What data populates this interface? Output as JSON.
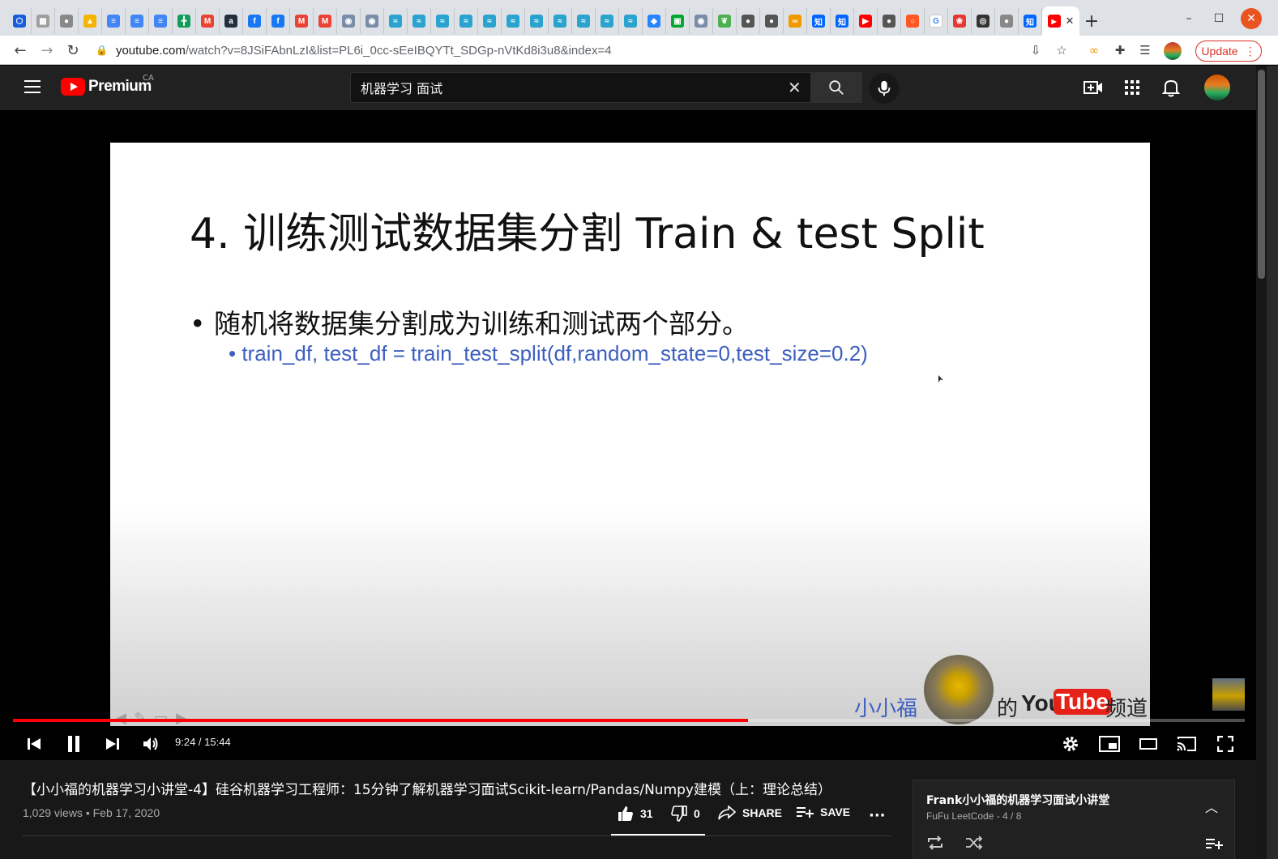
{
  "browser": {
    "tab_favicons": [
      {
        "name": "bitwarden",
        "color": "#175ddc",
        "glyph": "⬡"
      },
      {
        "name": "app",
        "color": "#9e9e9e",
        "glyph": "▦"
      },
      {
        "name": "github",
        "color": "#888888",
        "glyph": "●"
      },
      {
        "name": "google-drive",
        "color": "#f4b400",
        "glyph": "▲"
      },
      {
        "name": "google-docs",
        "color": "#4285f4",
        "glyph": "≡"
      },
      {
        "name": "google-docs",
        "color": "#4285f4",
        "glyph": "≡"
      },
      {
        "name": "google-docs",
        "color": "#4285f4",
        "glyph": "≡"
      },
      {
        "name": "google-sheets",
        "color": "#0f9d58",
        "glyph": "╋"
      },
      {
        "name": "gmail",
        "color": "#ea4335",
        "glyph": "M"
      },
      {
        "name": "amazon",
        "color": "#232f3e",
        "glyph": "a"
      },
      {
        "name": "facebook",
        "color": "#1877f2",
        "glyph": "f"
      },
      {
        "name": "facebook",
        "color": "#1877f2",
        "glyph": "f"
      },
      {
        "name": "gmail",
        "color": "#ea4335",
        "glyph": "M"
      },
      {
        "name": "gmail",
        "color": "#ea4335",
        "glyph": "M"
      },
      {
        "name": "site",
        "color": "#7a8ca8",
        "glyph": "◉"
      },
      {
        "name": "site",
        "color": "#7a8ca8",
        "glyph": "◉"
      },
      {
        "name": "site",
        "color": "#2aa3cf",
        "glyph": "≈"
      },
      {
        "name": "site",
        "color": "#2aa3cf",
        "glyph": "≈"
      },
      {
        "name": "site",
        "color": "#2aa3cf",
        "glyph": "≈"
      },
      {
        "name": "site",
        "color": "#2aa3cf",
        "glyph": "≈"
      },
      {
        "name": "site",
        "color": "#2aa3cf",
        "glyph": "≈"
      },
      {
        "name": "site",
        "color": "#2aa3cf",
        "glyph": "≈"
      },
      {
        "name": "site",
        "color": "#2aa3cf",
        "glyph": "≈"
      },
      {
        "name": "site",
        "color": "#2aa3cf",
        "glyph": "≈"
      },
      {
        "name": "site",
        "color": "#2aa3cf",
        "glyph": "≈"
      },
      {
        "name": "site",
        "color": "#2aa3cf",
        "glyph": "≈"
      },
      {
        "name": "site",
        "color": "#2aa3cf",
        "glyph": "≈"
      },
      {
        "name": "jira",
        "color": "#2684ff",
        "glyph": "◆"
      },
      {
        "name": "evernote",
        "color": "#00a82d",
        "glyph": "▣"
      },
      {
        "name": "site",
        "color": "#7a8ca8",
        "glyph": "◉"
      },
      {
        "name": "leaf",
        "color": "#4caf50",
        "glyph": "❦"
      },
      {
        "name": "github",
        "color": "#555555",
        "glyph": "●"
      },
      {
        "name": "github",
        "color": "#555555",
        "glyph": "●"
      },
      {
        "name": "infinity",
        "color": "#f29900",
        "glyph": "∞"
      },
      {
        "name": "zhihu",
        "color": "#0066ff",
        "glyph": "知"
      },
      {
        "name": "zhihu",
        "color": "#0066ff",
        "glyph": "知"
      },
      {
        "name": "youtube",
        "color": "#ff0000",
        "glyph": "▶"
      },
      {
        "name": "github",
        "color": "#555555",
        "glyph": "●"
      },
      {
        "name": "ring",
        "color": "#ff5722",
        "glyph": "○"
      },
      {
        "name": "google",
        "color": "#ffffff",
        "glyph": "G"
      },
      {
        "name": "red-app",
        "color": "#e53935",
        "glyph": "❀"
      },
      {
        "name": "search",
        "color": "#333333",
        "glyph": "◎"
      },
      {
        "name": "github",
        "color": "#888888",
        "glyph": "●"
      },
      {
        "name": "zhihu",
        "color": "#0066ff",
        "glyph": "知"
      }
    ],
    "active_tab_favicon": {
      "name": "youtube",
      "color": "#ff0000"
    },
    "url_host": "youtube.com",
    "url_rest": "/watch?v=8JSiFAbnLzI&list=PL6i_0cc-sEeIBQYTt_SDGp-nVtKd8i3u8&index=4",
    "update_label": "Update"
  },
  "youtube": {
    "logo_text": "Premium",
    "country_code": "CA",
    "search_value": "机器学习 面试",
    "colors": {
      "brand_red": "#ff0000",
      "bg": "#181818",
      "header": "#212121"
    }
  },
  "video": {
    "slide_title": "4. 训练测试数据集分割 Train & test Split",
    "slide_bullet": "• 随机将数据集分割成为训练和测试两个部分。",
    "slide_code": "• train_df, test_df = train_test_split(df,random_state=0,test_size=0.2)",
    "watermark_left": "小小福",
    "watermark_mid": "的",
    "watermark_you": "You",
    "watermark_tube": "Tube",
    "watermark_right": "频道",
    "progress_fraction": 0.597,
    "time_display": "9:24 / 15:44"
  },
  "details": {
    "title": "【小小福的机器学习小讲堂-4】硅谷机器学习工程师：15分钟了解机器学习面试Scikit-learn/Pandas/Numpy建模（上：理论总结）",
    "meta": "1,029 views • Feb 17, 2020",
    "likes": "31",
    "dislikes": "0",
    "share_label": "SHARE",
    "save_label": "SAVE"
  },
  "playlist": {
    "title": "Frank小小福的机器学习面试小讲堂",
    "subtitle": "FuFu LeetCode - 4 / 8"
  }
}
